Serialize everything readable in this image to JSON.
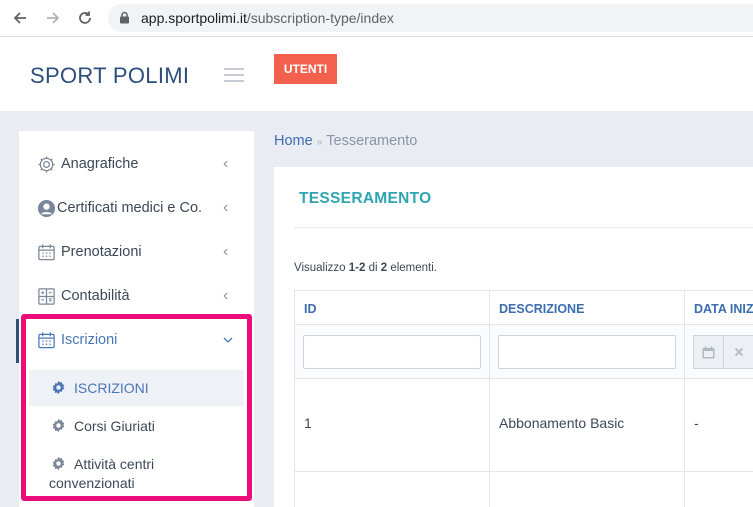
{
  "browser": {
    "url_host": "app.sportpolimi.it",
    "url_path": "/subscription-type/index"
  },
  "header": {
    "brand": "SPORT POLIMI",
    "utenti_button": "UTENTI"
  },
  "sidebar": {
    "items": [
      {
        "label": "Anagrafiche",
        "icon": "gear-icon",
        "chevron": "‹"
      },
      {
        "label": "Certificati medici e Co.",
        "icon": "user-circle-icon",
        "chevron": "‹"
      },
      {
        "label": "Prenotazioni",
        "icon": "calendar-icon",
        "chevron": "‹"
      },
      {
        "label": "Contabilità",
        "icon": "ledger-icon",
        "chevron": "‹"
      },
      {
        "label": "Iscrizioni",
        "icon": "calendar-icon",
        "chevron": "⌄"
      }
    ],
    "submenu": [
      {
        "label": "ISCRIZIONI",
        "icon": "cog-icon",
        "active": true
      },
      {
        "label": "Corsi Giuriati",
        "icon": "cog-icon",
        "active": false
      },
      {
        "label": "Attività centri",
        "label_cont": "convenzionati",
        "icon": "cog-icon",
        "active": false
      }
    ],
    "highlight_color": "#ec0d7a"
  },
  "breadcrumb": {
    "home": "Home",
    "separator": "»",
    "current": "Tesseramento"
  },
  "panel": {
    "title": "TESSERAMENTO",
    "summary_prefix": "Visualizzo ",
    "summary_range": "1-2",
    "summary_mid": " di ",
    "summary_total": "2",
    "summary_suffix": " elementi."
  },
  "table": {
    "columns": [
      "ID",
      "DESCRIZIONE",
      "DATA INIZIO"
    ],
    "rows": [
      [
        "1",
        "Abbonamento Basic",
        "-"
      ]
    ]
  },
  "colors": {
    "brand": "#2d4f7c",
    "accent_button": "#f4604e",
    "panel_title": "#2fa4b3",
    "link": "#3c6db0"
  }
}
